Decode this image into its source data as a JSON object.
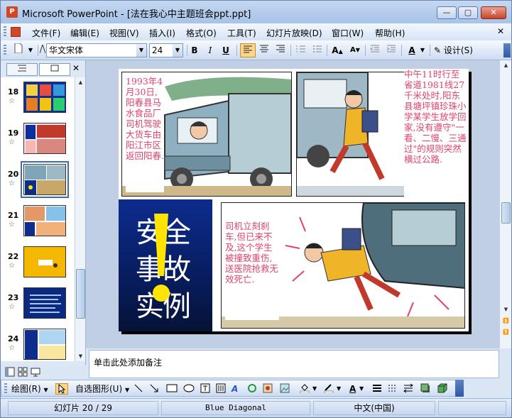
{
  "window": {
    "title": "Microsoft PowerPoint - [法在我心中主题班会ppt.ppt]",
    "app_icon": "P",
    "min_label": "—",
    "max_label": "▢",
    "close_label": "✕"
  },
  "menubar": {
    "items": [
      "文件(F)",
      "编辑(E)",
      "视图(V)",
      "插入(I)",
      "格式(O)",
      "工具(T)",
      "幻灯片放映(D)",
      "窗口(W)",
      "帮助(H)"
    ],
    "close_doc": "✕"
  },
  "toolbar": {
    "font_name": "华文宋体",
    "font_size": "24",
    "bold": "B",
    "italic": "I",
    "underline": "U",
    "design_label": "设计(S)"
  },
  "left_pane": {
    "tab_outline_icon": "outline-tab-icon",
    "tab_slides_icon": "slides-tab-icon",
    "close": "✕",
    "thumbnails": [
      {
        "number": "18",
        "star": "☆"
      },
      {
        "number": "19",
        "star": "☆"
      },
      {
        "number": "20",
        "star": "☆"
      },
      {
        "number": "21",
        "star": "☆"
      },
      {
        "number": "22",
        "star": "☆"
      },
      {
        "number": "23",
        "star": "☆"
      },
      {
        "number": "24",
        "star": "☆"
      }
    ],
    "selected_slide": "20"
  },
  "slide": {
    "caption1": "1993年4月30日,阳春县马水食品厂司机驾驶大货车由阳江市区返回阳春.",
    "caption2": "中午11时行至省道1981线27千米处时,阳东县塘坪镇珍珠小学某学生放学回家,没有遵守\"一看、二慢、三通过\"的规则突然横过公路.",
    "caption3": "司机立刻刹车,但已来不及,这个学生被撞致重伤,送医院抢救无效死亡.",
    "title_chars": [
      "安",
      "全",
      "事",
      "故",
      "实",
      "例"
    ],
    "accent_color": "#e0426b",
    "title_bg": "#0c2c8e"
  },
  "notes": {
    "placeholder": "单击此处添加备注"
  },
  "drawbar": {
    "draw_label": "绘图(R)",
    "autoshapes_label": "自选图形(U)"
  },
  "statusbar": {
    "slide_info": "幻灯片 20 / 29",
    "design_name": "Blue Diagonal",
    "language": "中文(中国)"
  }
}
